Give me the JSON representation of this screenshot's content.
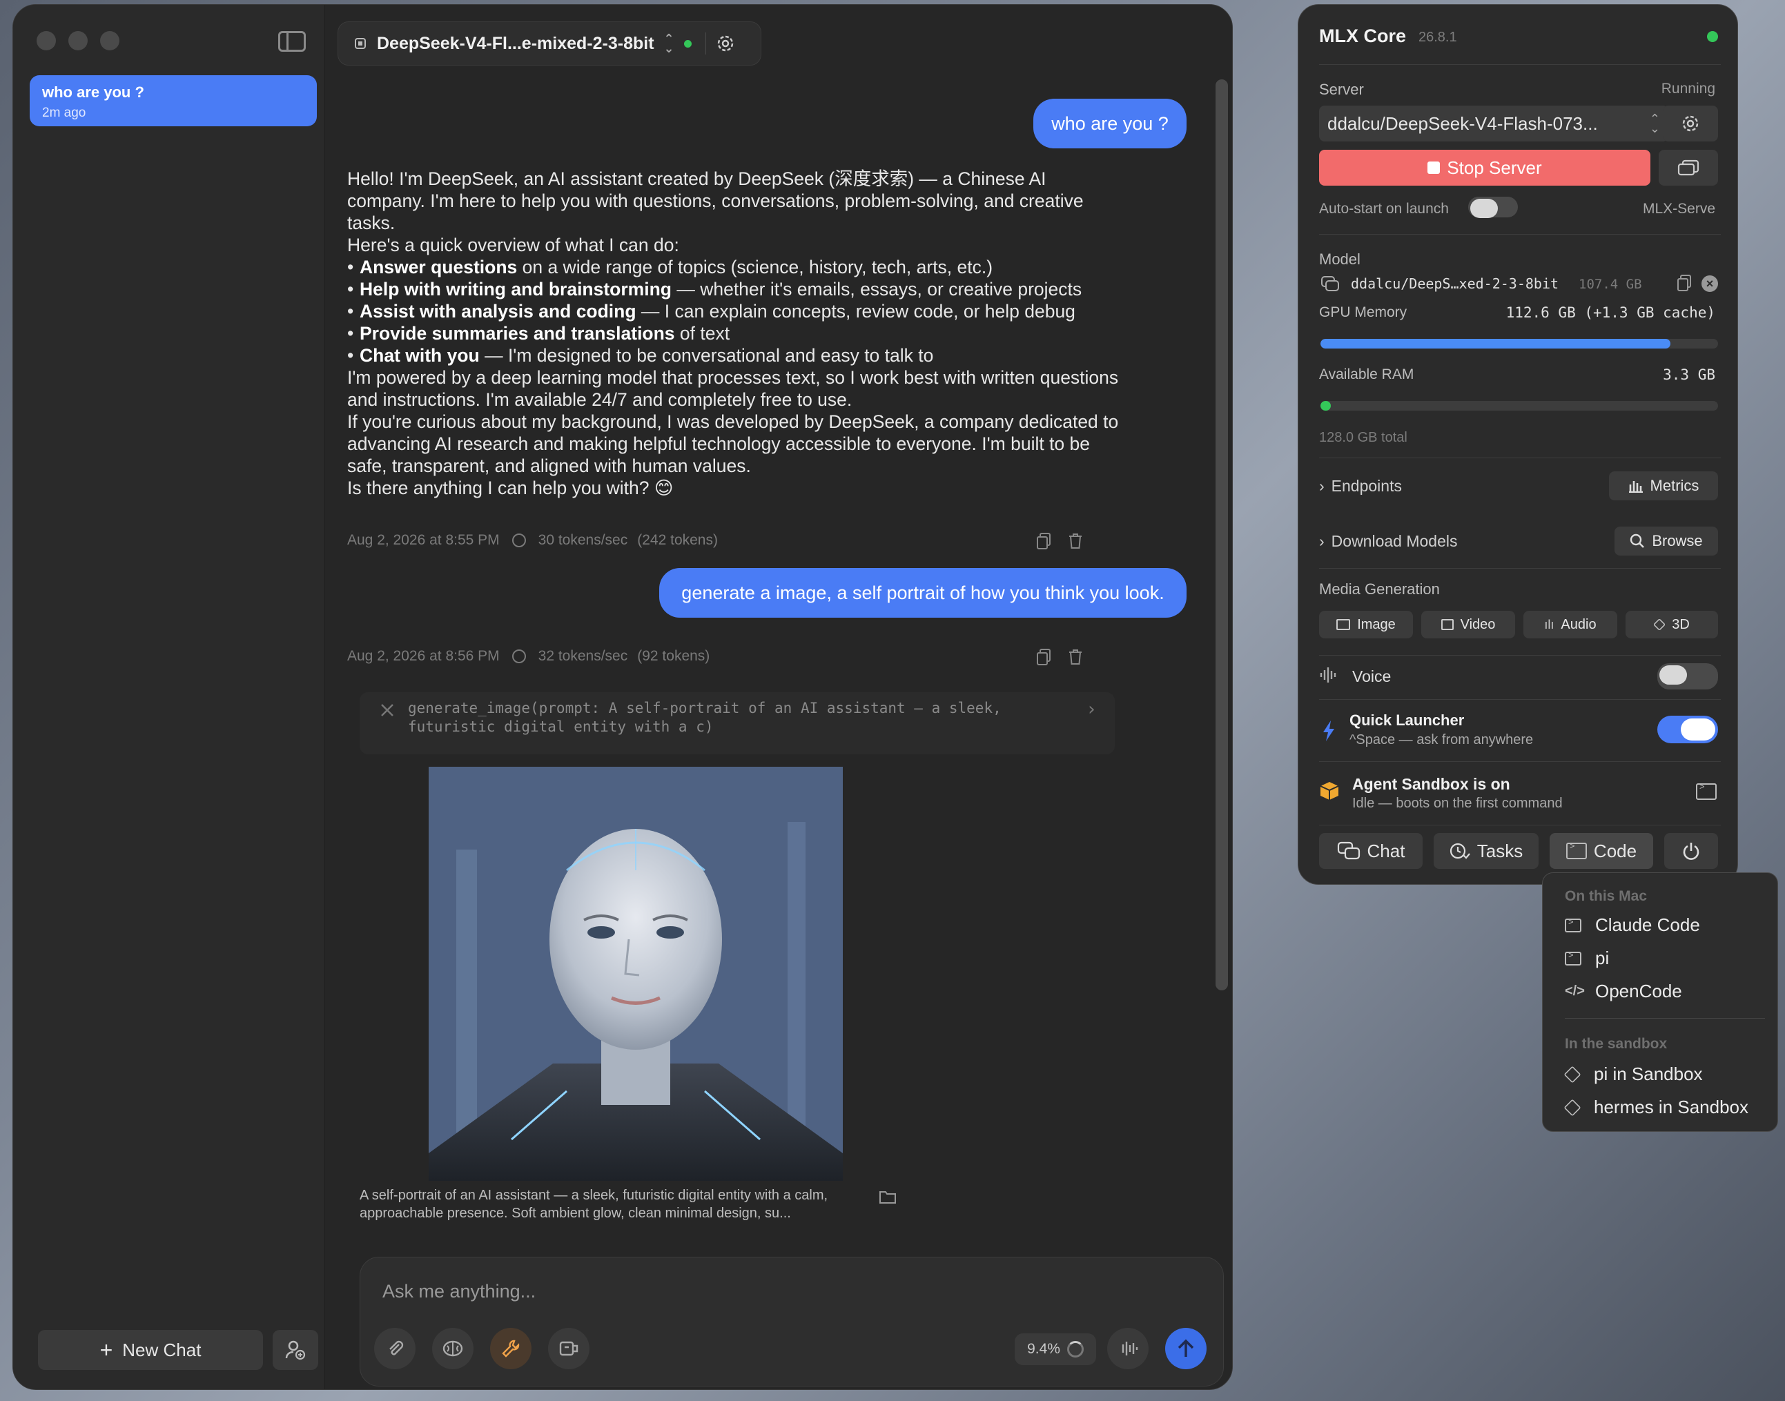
{
  "chat_window": {
    "sidebar": {
      "chat_item": {
        "title": "who are you ?",
        "subtitle": "2m ago"
      },
      "new_chat_label": "New Chat"
    },
    "header": {
      "model_name": "DeepSeek-V4-Fl...e-mixed-2-3-8bit"
    },
    "messages": {
      "user1": "who are you ?",
      "assistant1": {
        "p1": "Hello! I'm DeepSeek, an AI assistant created by DeepSeek (深度求索) — a Chinese AI company. I'm here to help you with questions, conversations, problem-solving, and creative tasks.",
        "p2": "Here's a quick overview of what I can do:",
        "b1_bold": "Answer questions",
        "b1_rest": " on a wide range of topics (science, history, tech, arts, etc.)",
        "b2_bold": "Help with writing and brainstorming",
        "b2_rest": " — whether it's emails, essays, or creative projects",
        "b3_bold": "Assist with analysis and coding",
        "b3_rest": " — I can explain concepts, review code, or help debug",
        "b4_bold": "Provide summaries and translations",
        "b4_rest": " of text",
        "b5_bold": "Chat with you",
        "b5_rest": " — I'm designed to be conversational and easy to talk to",
        "p3": "I'm powered by a deep learning model that processes text, so I work best with written questions and instructions. I'm available 24/7 and completely free to use.",
        "p4": "If you're curious about my background, I was developed by DeepSeek, a company dedicated to advancing AI research and making helpful technology accessible to everyone. I'm built to be safe, transparent, and aligned with human values.",
        "p5": "Is there anything I can help you with? 😊"
      },
      "meta1": {
        "time": "Aug 2, 2026 at 8:55 PM",
        "speed": "30 tokens/sec",
        "tokens": "(242 tokens)"
      },
      "user2": "generate a image, a self portrait of how you think you look.",
      "meta2": {
        "time": "Aug 2, 2026 at 8:56 PM",
        "speed": "32 tokens/sec",
        "tokens": "(92 tokens)"
      },
      "tool_call": {
        "line1": "generate_image(prompt: A self-portrait of an AI assistant — a sleek,",
        "line2": "futuristic digital entity with a c)"
      },
      "image_caption": "A self-portrait of an AI assistant — a sleek, futuristic digital entity with a calm, approachable presence. Soft ambient glow, clean minimal design, su..."
    },
    "input": {
      "placeholder": "Ask me anything...",
      "context_usage": "9.4%"
    }
  },
  "mlx_panel": {
    "title": "MLX Core",
    "version": "26.8.1",
    "server": {
      "label": "Server",
      "status": "Running",
      "model_select": "ddalcu/DeepSeek-V4-Flash-073...",
      "stop_label": "Stop Server",
      "autostart_label": "Auto-start on launch",
      "backend": "MLX-Serve"
    },
    "model": {
      "label": "Model",
      "name": "ddalcu/DeepS…xed-2-3-8bit",
      "size": "107.4 GB",
      "gpu_label": "GPU Memory",
      "gpu_value": "112.6 GB (+1.3 GB cache)",
      "gpu_fraction": 0.88,
      "ram_label": "Available RAM",
      "ram_value": "3.3 GB",
      "ram_fraction": 0.026,
      "ram_total": "128.0 GB total"
    },
    "endpoints_label": "Endpoints",
    "metrics_label": "Metrics",
    "download_label": "Download Models",
    "browse_label": "Browse",
    "media": {
      "label": "Media Generation",
      "buttons": [
        "Image",
        "Video",
        "Audio",
        "3D"
      ]
    },
    "voice_label": "Voice",
    "quick_launcher": {
      "title": "Quick Launcher",
      "subtitle": "^Space — ask from anywhere"
    },
    "sandbox": {
      "title": "Agent Sandbox is on",
      "subtitle": "Idle — boots on the first command"
    },
    "bottom_tabs": [
      "Chat",
      "Tasks",
      "Code"
    ],
    "colors": {
      "accent": "#4a7cf5",
      "stop": "#f26b6b",
      "running": "#34c759",
      "sandbox": "#f0a830"
    }
  },
  "code_menu": {
    "section1": "On this Mac",
    "items1": [
      "Claude Code",
      "pi",
      "OpenCode"
    ],
    "section2": "In the sandbox",
    "items2": [
      "pi in Sandbox",
      "hermes in Sandbox"
    ]
  }
}
